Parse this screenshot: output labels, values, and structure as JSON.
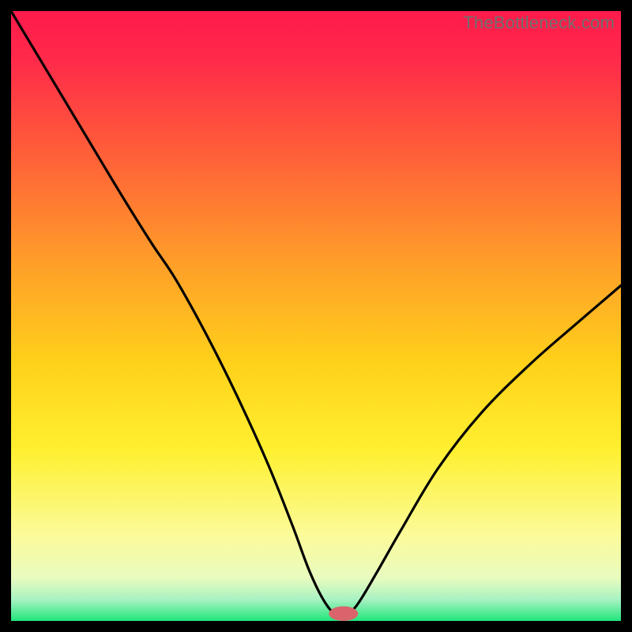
{
  "meta": {
    "watermark": "TheBottleneck.com"
  },
  "chart_data": {
    "type": "line",
    "title": "",
    "xlabel": "",
    "ylabel": "",
    "xlim": [
      0,
      100
    ],
    "ylim": [
      0,
      100
    ],
    "background_gradient_stops": [
      {
        "offset": 0.0,
        "color": "#ff1a4b"
      },
      {
        "offset": 0.08,
        "color": "#ff2a4a"
      },
      {
        "offset": 0.22,
        "color": "#ff5a3a"
      },
      {
        "offset": 0.4,
        "color": "#ff9a2a"
      },
      {
        "offset": 0.58,
        "color": "#ffd21a"
      },
      {
        "offset": 0.72,
        "color": "#fff030"
      },
      {
        "offset": 0.86,
        "color": "#fbfb9a"
      },
      {
        "offset": 0.93,
        "color": "#e8fbbf"
      },
      {
        "offset": 0.965,
        "color": "#a8f2c2"
      },
      {
        "offset": 1.0,
        "color": "#20e67a"
      }
    ],
    "series": [
      {
        "name": "bottleneck-curve",
        "x": [
          0,
          6,
          12,
          18,
          23,
          27,
          32,
          37,
          42,
          46,
          49,
          51.5,
          53.5,
          55.5,
          57,
          60,
          64,
          70,
          77,
          85,
          93,
          100
        ],
        "values": [
          100,
          90,
          80,
          70,
          62,
          56,
          47,
          37,
          26,
          16,
          8,
          3,
          1,
          1.5,
          3,
          8,
          15,
          25,
          34,
          42,
          49,
          55
        ]
      }
    ],
    "marker": {
      "x": 54.5,
      "y": 1.2,
      "rx": 2.4,
      "ry": 1.2,
      "color": "#d9646b"
    },
    "annotations": []
  }
}
